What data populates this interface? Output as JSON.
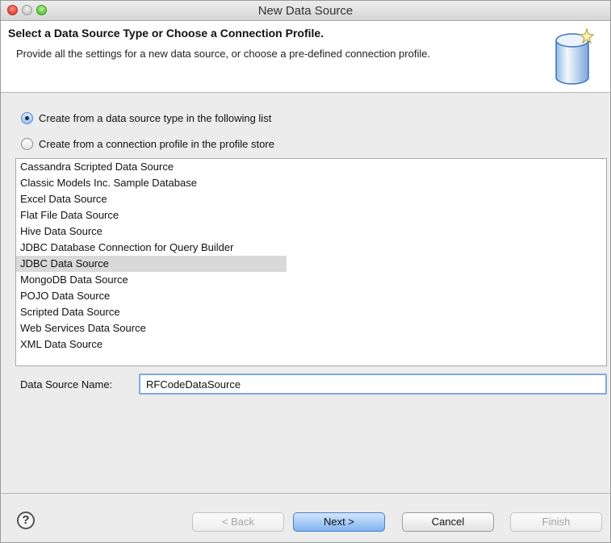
{
  "window": {
    "title": "New Data Source"
  },
  "header": {
    "title": "Select a Data Source Type or Choose a Connection Profile.",
    "description": "Provide all the settings for a new data source, or choose a pre-defined connection profile."
  },
  "options": {
    "from_type": "Create from a data source type in the following list",
    "from_profile": "Create from a connection profile in the profile store",
    "selected": "from_type"
  },
  "data_sources": [
    "Cassandra Scripted Data Source",
    "Classic Models Inc. Sample Database",
    "Excel Data Source",
    "Flat File Data Source",
    "Hive Data Source",
    "JDBC Database Connection for Query Builder",
    "JDBC Data Source",
    "MongoDB Data Source",
    "POJO Data Source",
    "Scripted Data Source",
    "Web Services Data Source",
    "XML Data Source"
  ],
  "selected_source": "JDBC Data Source",
  "name_field": {
    "label": "Data Source Name:",
    "value": "RFCodeDataSource"
  },
  "buttons": {
    "help": "?",
    "back": "< Back",
    "next": "Next >",
    "cancel": "Cancel",
    "finish": "Finish"
  }
}
